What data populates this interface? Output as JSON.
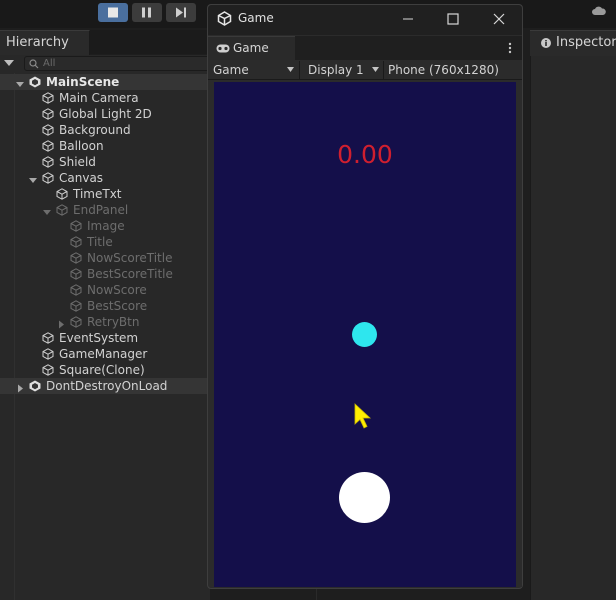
{
  "toolbar": {
    "buttons": [
      {
        "name": "stop-button",
        "icon": "stop-icon"
      },
      {
        "name": "pause-button",
        "icon": "pause-icon"
      },
      {
        "name": "step-button",
        "icon": "step-icon"
      }
    ]
  },
  "hierarchy": {
    "tab_label": "Hierarchy",
    "search_placeholder": "All",
    "rows": [
      {
        "label": "MainScene",
        "indent": 0,
        "type": "scene",
        "expanded": true,
        "disabled": false
      },
      {
        "label": "Main Camera",
        "indent": 1,
        "type": "object",
        "disabled": false
      },
      {
        "label": "Global Light 2D",
        "indent": 1,
        "type": "object",
        "disabled": false
      },
      {
        "label": "Background",
        "indent": 1,
        "type": "object",
        "disabled": false
      },
      {
        "label": "Balloon",
        "indent": 1,
        "type": "object",
        "disabled": false
      },
      {
        "label": "Shield",
        "indent": 1,
        "type": "object",
        "disabled": false
      },
      {
        "label": "Canvas",
        "indent": 1,
        "type": "object",
        "expanded": true,
        "disabled": false
      },
      {
        "label": "TimeTxt",
        "indent": 2,
        "type": "object",
        "disabled": false
      },
      {
        "label": "EndPanel",
        "indent": 2,
        "type": "object",
        "expanded": true,
        "disabled": true
      },
      {
        "label": "Image",
        "indent": 3,
        "type": "object",
        "disabled": true
      },
      {
        "label": "Title",
        "indent": 3,
        "type": "object",
        "disabled": true
      },
      {
        "label": "NowScoreTitle",
        "indent": 3,
        "type": "object",
        "disabled": true
      },
      {
        "label": "BestScoreTitle",
        "indent": 3,
        "type": "object",
        "disabled": true
      },
      {
        "label": "NowScore",
        "indent": 3,
        "type": "object",
        "disabled": true
      },
      {
        "label": "BestScore",
        "indent": 3,
        "type": "object",
        "disabled": true
      },
      {
        "label": "RetryBtn",
        "indent": 3,
        "type": "object",
        "expanded": false,
        "disabled": true
      },
      {
        "label": "EventSystem",
        "indent": 1,
        "type": "object",
        "disabled": false
      },
      {
        "label": "GameManager",
        "indent": 1,
        "type": "object",
        "disabled": false
      },
      {
        "label": "Square(Clone)",
        "indent": 1,
        "type": "object",
        "disabled": false
      },
      {
        "label": "DontDestroyOnLoad",
        "indent": 0,
        "type": "scene",
        "expanded": false,
        "disabled": false
      }
    ]
  },
  "game_window": {
    "title": "Game",
    "tab_label": "Game",
    "mode_dropdown": "Game",
    "display_dropdown": "Display 1",
    "resolution_dropdown": "Phone (760x1280)",
    "score_text": "0.00",
    "colors": {
      "viewport": "#140f4a",
      "score": "#cf1f2f",
      "small_ball": "#2ee6ee",
      "big_ball": "#ffffff",
      "cursor": "#ffee00"
    }
  },
  "inspector": {
    "tab_label": "Inspector"
  }
}
